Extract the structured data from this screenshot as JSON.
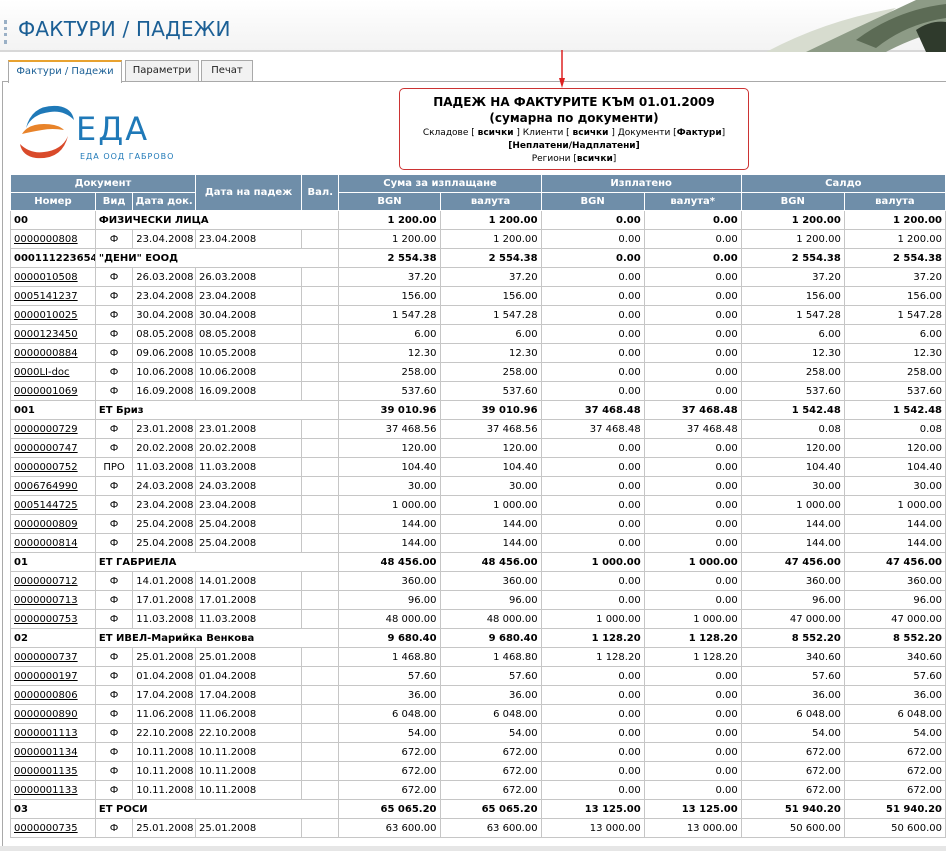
{
  "window": {
    "title": "ФАКТУРИ / ПАДЕЖИ"
  },
  "tabs": [
    {
      "label": "Фактури / Падежи",
      "active": true
    },
    {
      "label": "Параметри",
      "active": false
    },
    {
      "label": "Печат",
      "active": false
    }
  ],
  "logo": {
    "name": "ЕДА",
    "subtitle": "ЕДА ООД ГАБРОВО"
  },
  "report": {
    "title": "ПАДЕЖ НА ФАКТУРИТЕ КЪМ 01.01.2009",
    "subtitle": "(сумарна по документи)",
    "filter_line1_a": "Складове [ ",
    "filter_line1_b": "всички",
    "filter_line1_c": " ]  Клиенти [ ",
    "filter_line1_d": "всички",
    "filter_line1_e": " ] Документи [",
    "filter_line1_f": "Фактури",
    "filter_line1_g": "]",
    "filter_line2": "[Неплатени/Надплатени]",
    "filter_line3_a": "Региони [",
    "filter_line3_b": "всички",
    "filter_line3_c": "]"
  },
  "table": {
    "headers": {
      "document": "Документ",
      "due_date": "Дата на падеж",
      "currency": "Вал.",
      "amount_due": "Сума за изплащане",
      "paid": "Изплатено",
      "balance": "Салдо"
    },
    "subheaders": {
      "number": "Номер",
      "type": "Вид",
      "doc_date": "Дата док.",
      "bgn1": "BGN",
      "cur1": "валута",
      "bgn2": "BGN",
      "cur2": "валута*",
      "bgn3": "BGN",
      "cur3": "валута"
    },
    "rows": [
      {
        "g": true,
        "c0": "00",
        "c1": "ФИЗИЧЕСКИ ЛИЦА",
        "c2": "",
        "c3": "",
        "c4": "",
        "c5": "1 200.00",
        "c6": "1 200.00",
        "c7": "0.00",
        "c8": "0.00",
        "c9": "1 200.00",
        "c10": "1 200.00"
      },
      {
        "g": false,
        "c0": "0000000808",
        "c1": "Ф",
        "c2": "23.04.2008",
        "c3": "23.04.2008",
        "c4": "",
        "c5": "1 200.00",
        "c6": "1 200.00",
        "c7": "0.00",
        "c8": "0.00",
        "c9": "1 200.00",
        "c10": "1 200.00"
      },
      {
        "g": true,
        "c0": "000111223654",
        "c1": "\"ДЕНИ\" ЕООД",
        "c2": "",
        "c3": "",
        "c4": "",
        "c5": "2 554.38",
        "c6": "2 554.38",
        "c7": "0.00",
        "c8": "0.00",
        "c9": "2 554.38",
        "c10": "2 554.38"
      },
      {
        "g": false,
        "c0": "0000010508",
        "c1": "Ф",
        "c2": "26.03.2008",
        "c3": "26.03.2008",
        "c4": "",
        "c5": "37.20",
        "c6": "37.20",
        "c7": "0.00",
        "c8": "0.00",
        "c9": "37.20",
        "c10": "37.20"
      },
      {
        "g": false,
        "c0": "0005141237",
        "c1": "Ф",
        "c2": "23.04.2008",
        "c3": "23.04.2008",
        "c4": "",
        "c5": "156.00",
        "c6": "156.00",
        "c7": "0.00",
        "c8": "0.00",
        "c9": "156.00",
        "c10": "156.00"
      },
      {
        "g": false,
        "c0": "0000010025",
        "c1": "Ф",
        "c2": "30.04.2008",
        "c3": "30.04.2008",
        "c4": "",
        "c5": "1 547.28",
        "c6": "1 547.28",
        "c7": "0.00",
        "c8": "0.00",
        "c9": "1 547.28",
        "c10": "1 547.28"
      },
      {
        "g": false,
        "c0": "0000123450",
        "c1": "Ф",
        "c2": "08.05.2008",
        "c3": "08.05.2008",
        "c4": "",
        "c5": "6.00",
        "c6": "6.00",
        "c7": "0.00",
        "c8": "0.00",
        "c9": "6.00",
        "c10": "6.00"
      },
      {
        "g": false,
        "c0": "0000000884",
        "c1": "Ф",
        "c2": "09.06.2008",
        "c3": "10.05.2008",
        "c4": "",
        "c5": "12.30",
        "c6": "12.30",
        "c7": "0.00",
        "c8": "0.00",
        "c9": "12.30",
        "c10": "12.30"
      },
      {
        "g": false,
        "c0": "0000LI-doc",
        "c1": "Ф",
        "c2": "10.06.2008",
        "c3": "10.06.2008",
        "c4": "",
        "c5": "258.00",
        "c6": "258.00",
        "c7": "0.00",
        "c8": "0.00",
        "c9": "258.00",
        "c10": "258.00"
      },
      {
        "g": false,
        "c0": "0000001069",
        "c1": "Ф",
        "c2": "16.09.2008",
        "c3": "16.09.2008",
        "c4": "",
        "c5": "537.60",
        "c6": "537.60",
        "c7": "0.00",
        "c8": "0.00",
        "c9": "537.60",
        "c10": "537.60"
      },
      {
        "g": true,
        "c0": "001",
        "c1": "ЕТ Бриз",
        "c2": "",
        "c3": "",
        "c4": "",
        "c5": "39 010.96",
        "c6": "39 010.96",
        "c7": "37 468.48",
        "c8": "37 468.48",
        "c9": "1 542.48",
        "c10": "1 542.48"
      },
      {
        "g": false,
        "c0": "0000000729",
        "c1": "Ф",
        "c2": "23.01.2008",
        "c3": "23.01.2008",
        "c4": "",
        "c5": "37 468.56",
        "c6": "37 468.56",
        "c7": "37 468.48",
        "c8": "37 468.48",
        "c9": "0.08",
        "c10": "0.08"
      },
      {
        "g": false,
        "c0": "0000000747",
        "c1": "Ф",
        "c2": "20.02.2008",
        "c3": "20.02.2008",
        "c4": "",
        "c5": "120.00",
        "c6": "120.00",
        "c7": "0.00",
        "c8": "0.00",
        "c9": "120.00",
        "c10": "120.00"
      },
      {
        "g": false,
        "c0": "0000000752",
        "c1": "ПРО",
        "c2": "11.03.2008",
        "c3": "11.03.2008",
        "c4": "",
        "c5": "104.40",
        "c6": "104.40",
        "c7": "0.00",
        "c8": "0.00",
        "c9": "104.40",
        "c10": "104.40"
      },
      {
        "g": false,
        "c0": "0006764990",
        "c1": "Ф",
        "c2": "24.03.2008",
        "c3": "24.03.2008",
        "c4": "",
        "c5": "30.00",
        "c6": "30.00",
        "c7": "0.00",
        "c8": "0.00",
        "c9": "30.00",
        "c10": "30.00"
      },
      {
        "g": false,
        "c0": "0005144725",
        "c1": "Ф",
        "c2": "23.04.2008",
        "c3": "23.04.2008",
        "c4": "",
        "c5": "1 000.00",
        "c6": "1 000.00",
        "c7": "0.00",
        "c8": "0.00",
        "c9": "1 000.00",
        "c10": "1 000.00"
      },
      {
        "g": false,
        "c0": "0000000809",
        "c1": "Ф",
        "c2": "25.04.2008",
        "c3": "25.04.2008",
        "c4": "",
        "c5": "144.00",
        "c6": "144.00",
        "c7": "0.00",
        "c8": "0.00",
        "c9": "144.00",
        "c10": "144.00"
      },
      {
        "g": false,
        "c0": "0000000814",
        "c1": "Ф",
        "c2": "25.04.2008",
        "c3": "25.04.2008",
        "c4": "",
        "c5": "144.00",
        "c6": "144.00",
        "c7": "0.00",
        "c8": "0.00",
        "c9": "144.00",
        "c10": "144.00"
      },
      {
        "g": true,
        "c0": "01",
        "c1": "ЕТ ГАБРИЕЛА",
        "c2": "",
        "c3": "",
        "c4": "",
        "c5": "48 456.00",
        "c6": "48 456.00",
        "c7": "1 000.00",
        "c8": "1 000.00",
        "c9": "47 456.00",
        "c10": "47 456.00"
      },
      {
        "g": false,
        "c0": "0000000712",
        "c1": "Ф",
        "c2": "14.01.2008",
        "c3": "14.01.2008",
        "c4": "",
        "c5": "360.00",
        "c6": "360.00",
        "c7": "0.00",
        "c8": "0.00",
        "c9": "360.00",
        "c10": "360.00"
      },
      {
        "g": false,
        "c0": "0000000713",
        "c1": "Ф",
        "c2": "17.01.2008",
        "c3": "17.01.2008",
        "c4": "",
        "c5": "96.00",
        "c6": "96.00",
        "c7": "0.00",
        "c8": "0.00",
        "c9": "96.00",
        "c10": "96.00"
      },
      {
        "g": false,
        "c0": "0000000753",
        "c1": "Ф",
        "c2": "11.03.2008",
        "c3": "11.03.2008",
        "c4": "",
        "c5": "48 000.00",
        "c6": "48 000.00",
        "c7": "1 000.00",
        "c8": "1 000.00",
        "c9": "47 000.00",
        "c10": "47 000.00"
      },
      {
        "g": true,
        "c0": "02",
        "c1": "ЕТ ИВЕЛ-Марийка Венкова",
        "c2": "",
        "c3": "",
        "c4": "",
        "c5": "9 680.40",
        "c6": "9 680.40",
        "c7": "1 128.20",
        "c8": "1 128.20",
        "c9": "8 552.20",
        "c10": "8 552.20"
      },
      {
        "g": false,
        "c0": "0000000737",
        "c1": "Ф",
        "c2": "25.01.2008",
        "c3": "25.01.2008",
        "c4": "",
        "c5": "1 468.80",
        "c6": "1 468.80",
        "c7": "1 128.20",
        "c8": "1 128.20",
        "c9": "340.60",
        "c10": "340.60"
      },
      {
        "g": false,
        "c0": "0000000197",
        "c1": "Ф",
        "c2": "01.04.2008",
        "c3": "01.04.2008",
        "c4": "",
        "c5": "57.60",
        "c6": "57.60",
        "c7": "0.00",
        "c8": "0.00",
        "c9": "57.60",
        "c10": "57.60"
      },
      {
        "g": false,
        "c0": "0000000806",
        "c1": "Ф",
        "c2": "17.04.2008",
        "c3": "17.04.2008",
        "c4": "",
        "c5": "36.00",
        "c6": "36.00",
        "c7": "0.00",
        "c8": "0.00",
        "c9": "36.00",
        "c10": "36.00"
      },
      {
        "g": false,
        "c0": "0000000890",
        "c1": "Ф",
        "c2": "11.06.2008",
        "c3": "11.06.2008",
        "c4": "",
        "c5": "6 048.00",
        "c6": "6 048.00",
        "c7": "0.00",
        "c8": "0.00",
        "c9": "6 048.00",
        "c10": "6 048.00"
      },
      {
        "g": false,
        "c0": "0000001113",
        "c1": "Ф",
        "c2": "22.10.2008",
        "c3": "22.10.2008",
        "c4": "",
        "c5": "54.00",
        "c6": "54.00",
        "c7": "0.00",
        "c8": "0.00",
        "c9": "54.00",
        "c10": "54.00"
      },
      {
        "g": false,
        "c0": "0000001134",
        "c1": "Ф",
        "c2": "10.11.2008",
        "c3": "10.11.2008",
        "c4": "",
        "c5": "672.00",
        "c6": "672.00",
        "c7": "0.00",
        "c8": "0.00",
        "c9": "672.00",
        "c10": "672.00"
      },
      {
        "g": false,
        "c0": "0000001135",
        "c1": "Ф",
        "c2": "10.11.2008",
        "c3": "10.11.2008",
        "c4": "",
        "c5": "672.00",
        "c6": "672.00",
        "c7": "0.00",
        "c8": "0.00",
        "c9": "672.00",
        "c10": "672.00"
      },
      {
        "g": false,
        "c0": "0000001133",
        "c1": "Ф",
        "c2": "10.11.2008",
        "c3": "10.11.2008",
        "c4": "",
        "c5": "672.00",
        "c6": "672.00",
        "c7": "0.00",
        "c8": "0.00",
        "c9": "672.00",
        "c10": "672.00"
      },
      {
        "g": true,
        "c0": "03",
        "c1": "ЕТ РОСИ",
        "c2": "",
        "c3": "",
        "c4": "",
        "c5": "65 065.20",
        "c6": "65 065.20",
        "c7": "13 125.00",
        "c8": "13 125.00",
        "c9": "51 940.20",
        "c10": "51 940.20"
      },
      {
        "g": false,
        "c0": "0000000735",
        "c1": "Ф",
        "c2": "25.01.2008",
        "c3": "25.01.2008",
        "c4": "",
        "c5": "63 600.00",
        "c6": "63 600.00",
        "c7": "13 000.00",
        "c8": "13 000.00",
        "c9": "50 600.00",
        "c10": "50 600.00"
      }
    ]
  },
  "colors": {
    "header_bg": "#6f8ea9",
    "title_blue": "#1b5f95",
    "accent_orange": "#e8a230",
    "report_border": "#cc3333",
    "arrow": "#dd2222"
  }
}
